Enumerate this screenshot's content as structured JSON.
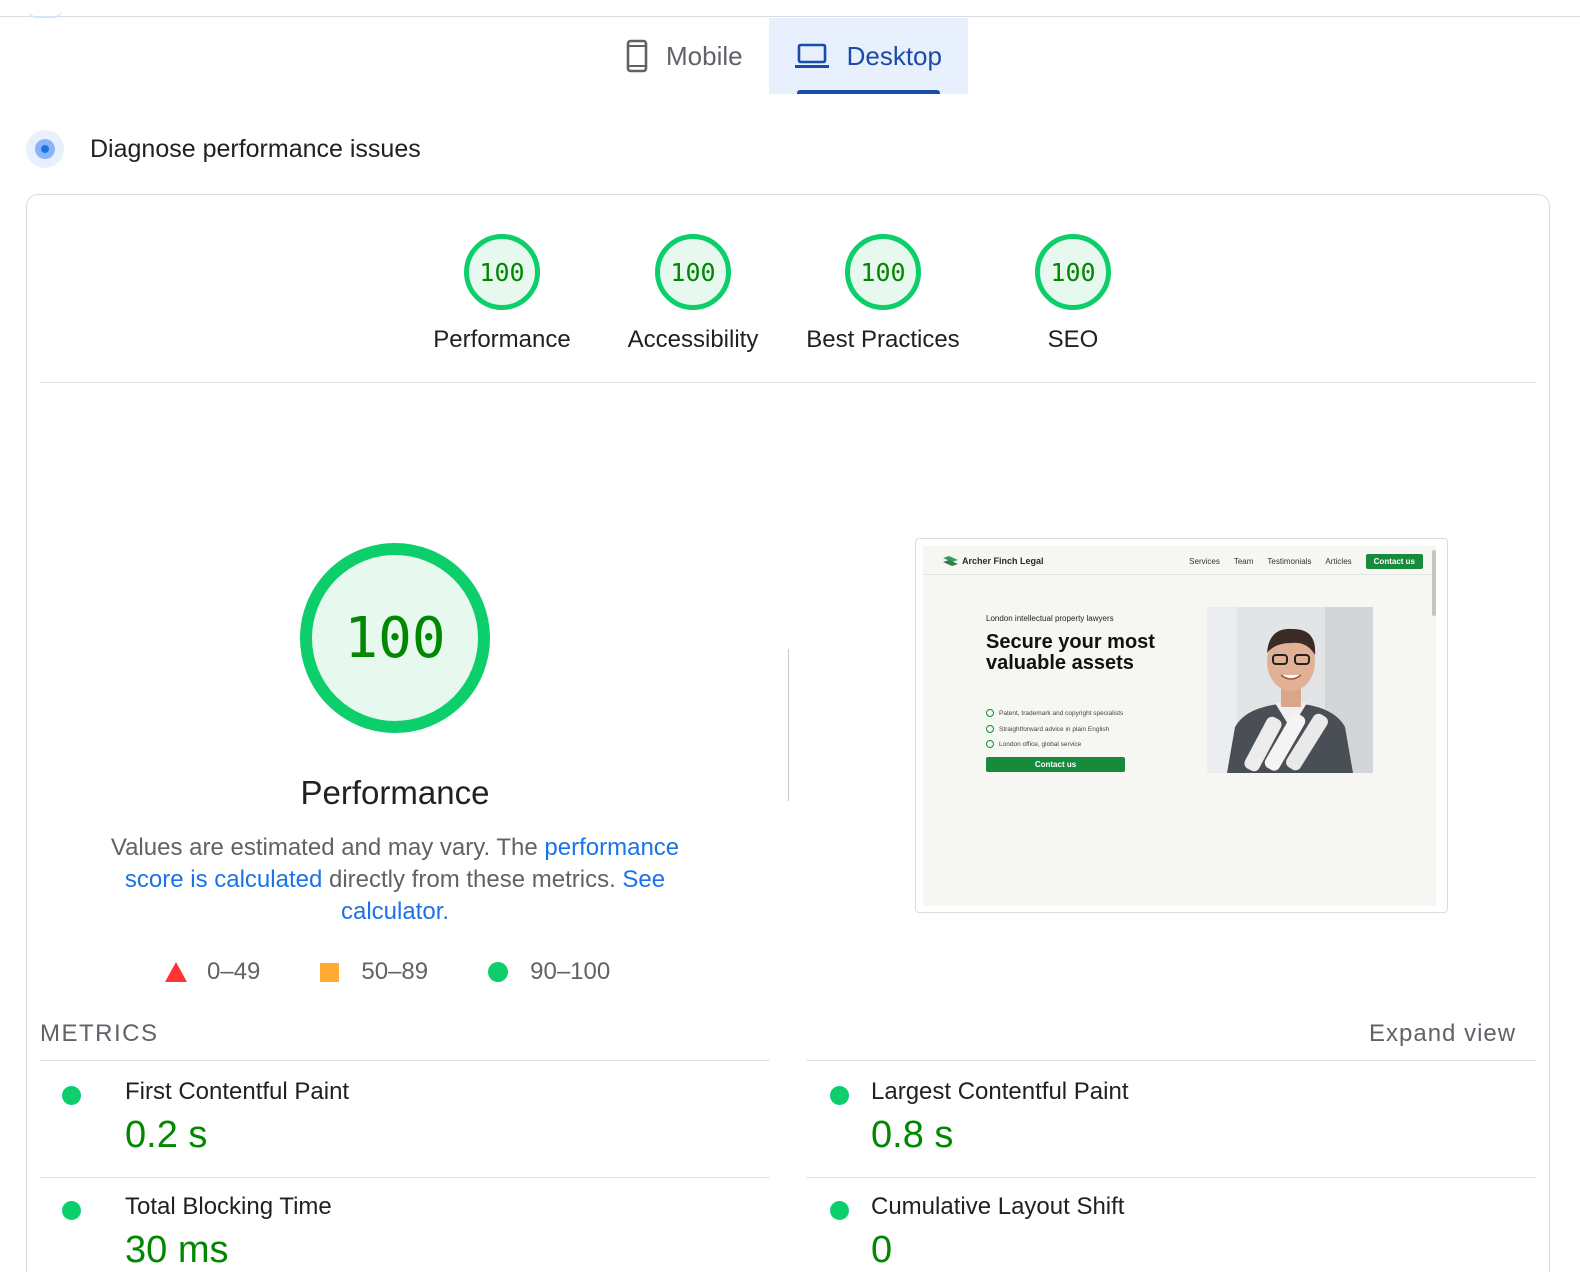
{
  "device_tabs": {
    "mobile_label": "Mobile",
    "desktop_label": "Desktop",
    "active": "Desktop"
  },
  "diagnose": {
    "title": "Diagnose performance issues"
  },
  "category_scores": [
    {
      "label": "Performance",
      "score": "100"
    },
    {
      "label": "Accessibility",
      "score": "100"
    },
    {
      "label": "Best Practices",
      "score": "100"
    },
    {
      "label": "SEO",
      "score": "100"
    }
  ],
  "main_gauge": {
    "score": "100",
    "title": "Performance",
    "desc_prefix": "Values are estimated and may vary. The ",
    "desc_link1": "performance score is calculated",
    "desc_middle": " directly from these metrics. ",
    "desc_link2": "See calculator."
  },
  "legend": {
    "fail": "0–49",
    "average": "50–89",
    "pass": "90–100",
    "colors": {
      "fail": "#ff3333",
      "average": "#ffaa33",
      "pass": "#0cce6b"
    }
  },
  "screenshot": {
    "brand": "Archer Finch Legal",
    "nav": [
      "Services",
      "Team",
      "Testimonials",
      "Articles"
    ],
    "nav_cta": "Contact us",
    "kicker": "London intellectual property lawyers",
    "headline": "Secure your most valuable assets",
    "bullets": [
      "Patent, trademark and copyright specialists",
      "Straightforward advice in plain English",
      "London office, global service"
    ],
    "button": "Contact us"
  },
  "metrics": {
    "heading": "METRICS",
    "expand_label": "Expand view",
    "items": [
      {
        "name": "First Contentful Paint",
        "value": "0.2 s"
      },
      {
        "name": "Largest Contentful Paint",
        "value": "0.8 s"
      },
      {
        "name": "Total Blocking Time",
        "value": "30 ms"
      },
      {
        "name": "Cumulative Layout Shift",
        "value": "0"
      }
    ]
  },
  "colors": {
    "pass_green": "#0cce6b",
    "score_text": "#008800",
    "accent_blue": "#1a73e8",
    "active_tab": "#1a4ba8"
  }
}
